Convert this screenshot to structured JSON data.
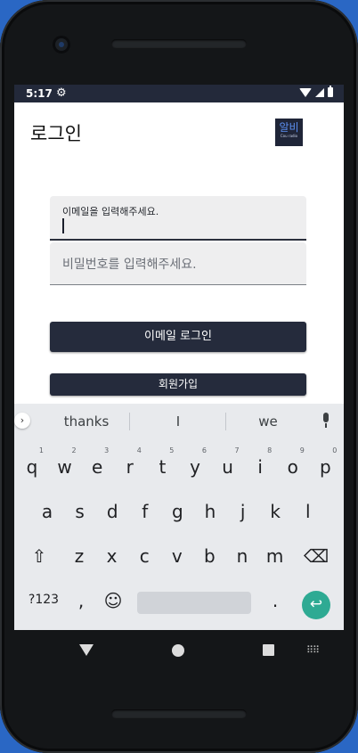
{
  "status": {
    "time": "5:17"
  },
  "header": {
    "title": "로그인",
    "logo_text": "알비",
    "logo_subtext": "Cou radio"
  },
  "form": {
    "email_label": "이메일을 입력해주세요.",
    "password_placeholder": "비밀번호를 입력해주세요.",
    "login_button": "이메일 로그인",
    "signup_button": "회원가입"
  },
  "keyboard": {
    "suggestions": [
      "thanks",
      "I",
      "we"
    ],
    "row1": [
      {
        "k": "q",
        "h": "1"
      },
      {
        "k": "w",
        "h": "2"
      },
      {
        "k": "e",
        "h": "3"
      },
      {
        "k": "r",
        "h": "4"
      },
      {
        "k": "t",
        "h": "5"
      },
      {
        "k": "y",
        "h": "6"
      },
      {
        "k": "u",
        "h": "7"
      },
      {
        "k": "i",
        "h": "8"
      },
      {
        "k": "o",
        "h": "9"
      },
      {
        "k": "p",
        "h": "0"
      }
    ],
    "row2": [
      "a",
      "s",
      "d",
      "f",
      "g",
      "h",
      "j",
      "k",
      "l"
    ],
    "row3": [
      "z",
      "x",
      "c",
      "v",
      "b",
      "n",
      "m"
    ],
    "symbols_key": "?123",
    "comma_key": ",",
    "emoji_key": "☺",
    "period_key": ".",
    "shift_icon": "⇧",
    "backspace_icon": "⌫",
    "enter_icon": "↩"
  },
  "colors": {
    "accent_dark": "#252b3c",
    "enter_key": "#2eaa93",
    "background": "#2a67c4"
  }
}
